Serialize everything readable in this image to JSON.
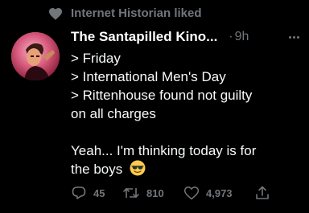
{
  "social_context": {
    "text": "Internet Historian liked",
    "icon": "heart-icon"
  },
  "author": {
    "name": "The Santapilled Kino...",
    "time": "9h"
  },
  "body": {
    "lines": [
      "> Friday",
      "> International Men's Day",
      "> Rittenhouse found not guilty",
      "on all charges",
      "",
      "Yeah... I'm thinking today is for",
      "the boys"
    ],
    "emoji": "smiling-face-with-sunglasses-icon"
  },
  "actions": {
    "replies": "45",
    "retweets": "810",
    "likes": "4,973"
  },
  "colors": {
    "background": "#000000",
    "text": "#e7e9ea",
    "secondary": "#71767b"
  }
}
